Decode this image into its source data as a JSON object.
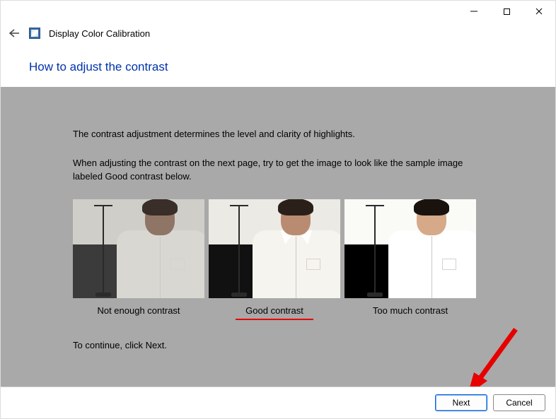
{
  "window": {
    "title": "Display Color Calibration"
  },
  "page": {
    "heading": "How to adjust the contrast",
    "description1": "The contrast adjustment determines the level and clarity of highlights.",
    "description2": "When adjusting the contrast on the next page, try to get the image to look like the sample image labeled Good contrast below.",
    "continue_text": "To continue, click Next."
  },
  "examples": {
    "not_enough": "Not enough contrast",
    "good": "Good contrast",
    "too_much": "Too much contrast"
  },
  "footer": {
    "next": "Next",
    "cancel": "Cancel"
  }
}
